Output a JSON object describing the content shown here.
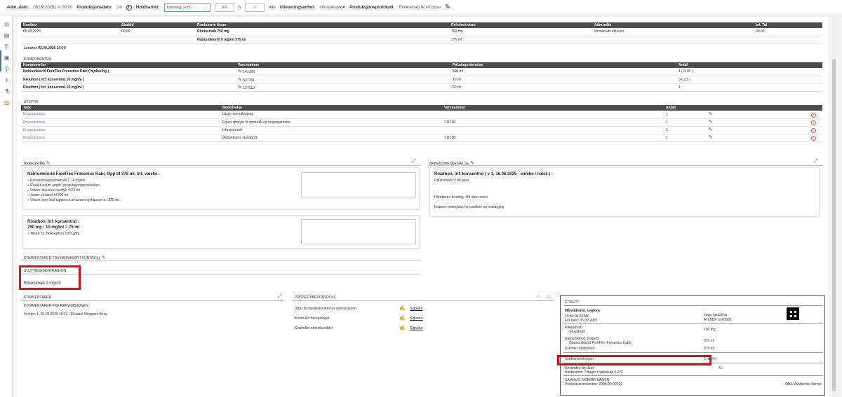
{
  "topbar": {
    "adm_label": "Adm. dato:",
    "adm_value": "05.09.2025 | kl 00:00",
    "prod_label": "Produksjonsdato:",
    "prod_value": "| kl",
    "hold_label": "Holdbarhet:",
    "hold_select": "Kjøleskap 2-8°C",
    "hold_input1": "168",
    "hold_unit1": "h",
    "hold_input2": "0",
    "hold_unit2": "min",
    "utlev_label": "Utleveringsenhet:",
    "utlev_value": "Infusjonspose",
    "protokoll_label": "Produksjonsprotokoll:",
    "protokoll_value": "Rituksimab IV inf.pose"
  },
  "kur_table": {
    "headers": [
      "Kurdato",
      "Starttid",
      "Produserte doser",
      "Rekvirert dose",
      "Adm.måte",
      "Inf. Tid"
    ],
    "rows": [
      [
        "05.09.2025",
        "00:00",
        "Rituksimab 750 mg",
        "750 mg",
        "Intravenøs infusjon",
        "00:00"
      ],
      [
        "",
        "",
        "Natriumklorid 9 mg/ml 375 ml",
        "375 ml",
        "",
        ""
      ]
    ],
    "leveres": "Leveres 05.09.2025 10:20"
  },
  "komponenter": {
    "section": "KOMPONENTER",
    "headers": [
      "Komponenter",
      "Varenummer",
      "Pakningsstørrelse",
      "Antall"
    ],
    "rows": [
      [
        "Natriumklorid FreeFlex Fresenius Kabi ( hydrering )",
        "141388",
        "500 ml",
        "1 ( 0.75 )"
      ],
      [
        "Rixathon ( inf. konsentrat 10 mg/ml )",
        "537151",
        "10 ml",
        "3 ( 2.5 )"
      ],
      [
        "Rixathon ( inf. konsentrat 10 mg/ml )",
        "137019",
        "50 ml",
        "1"
      ]
    ]
  },
  "utstyr": {
    "section": "UTSTYR",
    "headers": [
      "Type",
      "Beskrivelse",
      "Varenummer",
      "Antall"
    ],
    "rows": [
      [
        "Engangsutstyr",
        "Utstyr ved utlopping",
        "",
        "1"
      ],
      [
        "Engangsutstyr",
        "Egnet sprøyte til opptrekk og engangsutstyr",
        "711700",
        "1"
      ],
      [
        "Engangsutstyr",
        "Infusjonssett",
        "",
        "1"
      ],
      [
        "Engangsutstyr",
        "(Arbeidspris standard)",
        "711700",
        "1"
      ]
    ]
  },
  "beregning": {
    "section": "BEREGNING",
    "card1_title": "Natriumklorid FreeFlex Fresenius Kabi, Opp til 375 ml, Inf. væske :",
    "card1_items": [
      "» Konsentrasjonsintervall 1 - 4 mg/ml",
      "» Eksakt volum angitt i produksjonsprotokollen.",
      "» Volum inklusive overfyll : 525 ml",
      "» Juster volumet til 300 ml.",
      "» Volum som skal tappes ut av posen og kasseres : 225 ml."
    ],
    "card2_title1": "Rixathon, Inf. konsentrat :",
    "card2_title2": "750 mg : 10 mg/ml = 75 ml",
    "card2_items": [
      "» Tilsett 75 ml Rixathon 10 mg/ml."
    ]
  },
  "arbeid": {
    "section": "ARBEIDSBESKRIVELSE",
    "title": "Rixathon, Inf. konsentrat ( v 1, 16.06.2025 - elmibe / lialsk ) :",
    "line1": "Rituksimab IV inf.pose",
    "line2": "Håndteres forsiktig. Må ikke ristes!",
    "line3": "Inspiser hetteglass for partikler og misfarging"
  },
  "farmasoy": {
    "section": "KOMMENTARER FRA FARMASØYTKONTROLL"
  },
  "slutt": {
    "section": "SLUTTKONSENTRASJON",
    "value": "Rituksimab   2  mg/ml"
  },
  "kommentarer": {
    "section": "KOMMENTARER",
    "sub": "KOMMENTARER FRA REKVISISJONEN :",
    "line": "Versjon 1, 05.09.2025 10:22 / Elisabet Mingarini Berg :"
  },
  "prosedyre": {
    "section": "PROSEDYREKONTROLL",
    "rows": [
      {
        "label": "Utfør farmasøytkontroll av rekvisisjonen",
        "sig": "Signatur"
      },
      {
        "label": "Kontroller beregninger",
        "sig": "Signatur"
      },
      {
        "label": "Kontroller arbeidsseddel",
        "sig": "Signatur"
      }
    ]
  },
  "etikett": {
    "title": "ETIKETT",
    "name": "Måneblomst, Isadora",
    "id": "10.50.06 85286",
    "fordato": "For dato: 05.09.2025",
    "lege": "Lege (avdeling",
    "avd": "AH BUK pol B501",
    "drug1": "Rituksimab",
    "drug1b": "(Rixathon)",
    "drug1_val": "750 mg",
    "drug2": "Natriumklorid 9 mg/ml",
    "drug2b": "(Natriumklorid FreeFlex Fresenius Kabi)",
    "drug2_val": "375 ml",
    "estimert": "Estimert totalvolum :",
    "estimert_val": "375 ml",
    "slutt_label": "Sluttkonsentrasjon :",
    "slutt_val": "2 mg/ml",
    "anvendes": "Anvendes før dato:",
    "kl": "kl.:",
    "holdbarhet": "Holdbarhet: 7 dager i kjøleskap 2-8°C",
    "sa": "SA AHUS, NORDBYHAGEN",
    "prodnr": "Produksjonsnummer: 2025.09.00016",
    "obs": "OBS: Avvikende format"
  }
}
